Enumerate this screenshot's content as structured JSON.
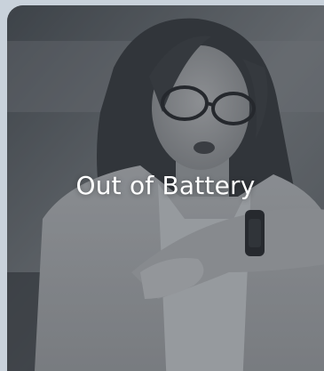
{
  "card": {
    "title": "Out of Battery",
    "image_subject": "woman-checking-smartwatch-photo"
  },
  "colors": {
    "page_background": "#c9d2db",
    "title_text": "#ffffff"
  }
}
